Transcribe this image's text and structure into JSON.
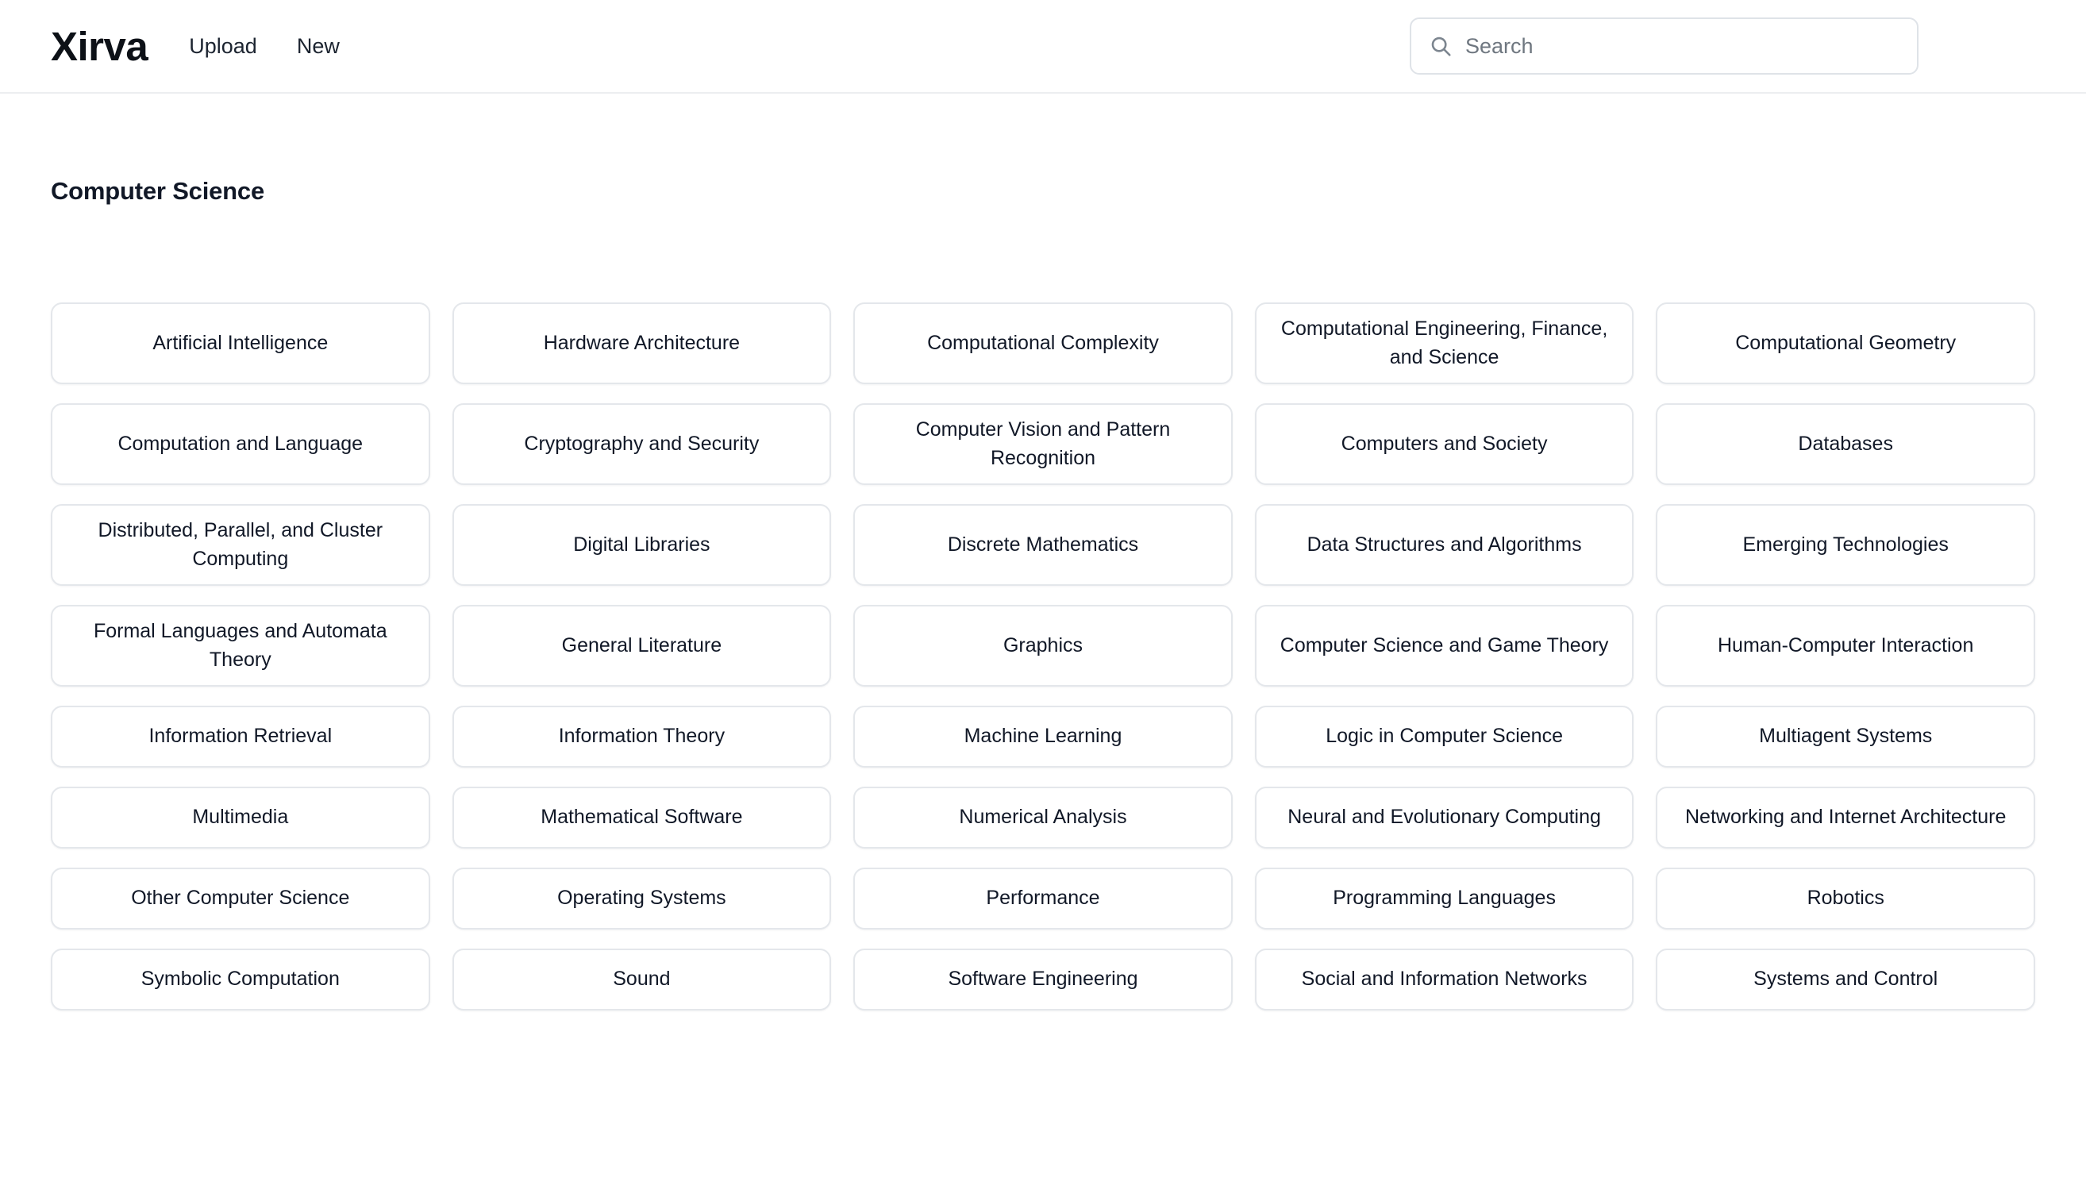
{
  "header": {
    "brand": "Xirva",
    "nav": [
      {
        "label": "Upload",
        "name": "nav-link-upload"
      },
      {
        "label": "New",
        "name": "nav-link-new"
      }
    ],
    "search": {
      "icon": "search-icon",
      "value": "",
      "placeholder": "Search"
    }
  },
  "main": {
    "page_title": "Computer Science",
    "categories": [
      "Artificial Intelligence",
      "Hardware Architecture",
      "Computational Complexity",
      "Computational Engineering, Finance, and Science",
      "Computational Geometry",
      "Computation and Language",
      "Cryptography and Security",
      "Computer Vision and Pattern Recognition",
      "Computers and Society",
      "Databases",
      "Distributed, Parallel, and Cluster Computing",
      "Digital Libraries",
      "Discrete Mathematics",
      "Data Structures and Algorithms",
      "Emerging Technologies",
      "Formal Languages and Automata Theory",
      "General Literature",
      "Graphics",
      "Computer Science and Game Theory",
      "Human-Computer Interaction",
      "Information Retrieval",
      "Information Theory",
      "Machine Learning",
      "Logic in Computer Science",
      "Multiagent Systems",
      "Multimedia",
      "Mathematical Software",
      "Numerical Analysis",
      "Neural and Evolutionary Computing",
      "Networking and Internet Architecture",
      "Other Computer Science",
      "Operating Systems",
      "Performance",
      "Programming Languages",
      "Robotics",
      "Symbolic Computation",
      "Sound",
      "Software Engineering",
      "Social and Information Networks",
      "Systems and Control"
    ]
  },
  "colors": {
    "page_background": "#ffffff",
    "text_primary": "#111827",
    "text_muted": "#6f7780",
    "card_border": "#e4e7eb",
    "header_divider": "#eceef0"
  }
}
